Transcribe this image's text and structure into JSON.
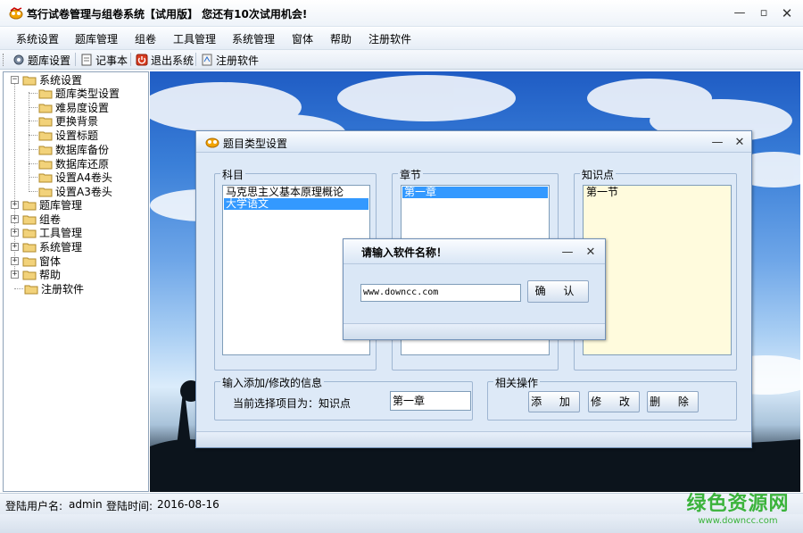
{
  "window": {
    "title": "笃行试卷管理与组卷系统【试用版】   您还有10次试用机会!"
  },
  "menu": [
    "系统设置",
    "题库管理",
    "组卷",
    "工具管理",
    "系统管理",
    "窗体",
    "帮助",
    "注册软件"
  ],
  "toolbar": {
    "item1": "题库设置",
    "item2": "记事本",
    "item3": "退出系统",
    "item4": "注册软件"
  },
  "tree": {
    "root_system": "系统设置",
    "system_children": [
      "题库类型设置",
      "难易度设置",
      "更换背景",
      "设置标题",
      "数据库备份",
      "数据库还原",
      "设置A4卷头",
      "设置A3卷头"
    ],
    "others": [
      "题库管理",
      "组卷",
      "工具管理",
      "系统管理",
      "窗体",
      "帮助"
    ],
    "register": "注册软件"
  },
  "dialog": {
    "title": "题目类型设置",
    "subject_label": "科目",
    "subjects": [
      "马克思主义基本原理概论",
      "大学语文"
    ],
    "chapter_label": "章节",
    "chapters": [
      "第一章"
    ],
    "knowledge_label": "知识点",
    "knowledge": [
      "第一节"
    ],
    "input_group_label": "输入添加/修改的信息",
    "current_label": "当前选择项目为：知识点",
    "current_value": "第一章",
    "ops_label": "相关操作",
    "add": "添 加",
    "edit": "修 改",
    "delete": "删 除"
  },
  "prompt": {
    "title": "请输入软件名称！",
    "input_value": "www.downcc.com",
    "confirm": "确 认"
  },
  "status": {
    "user_label": "登陆用户名:",
    "user": "admin",
    "time_label": "登陆时间:",
    "time": "2016-08-16"
  },
  "watermark": {
    "line1": "绿色资源网",
    "line2": "www.downcc.com"
  }
}
